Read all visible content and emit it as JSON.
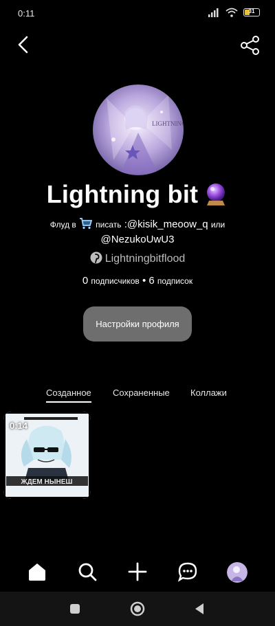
{
  "status": {
    "time": "0:11",
    "battery": "31"
  },
  "profile": {
    "name": "Lightning bit",
    "bio_pre": "Флуд в",
    "bio_mid": "писать",
    "bio_handle1": ":@kisik_meoow_q",
    "bio_or": "или",
    "bio_handle2": "@NezukoUwU3",
    "pinterest": "Lightningbitflood",
    "followers_count": "0",
    "followers_label": "подписчиков",
    "following_count": "6",
    "following_label": "подписок",
    "separator": "•",
    "settings_button": "Настройки профиля",
    "avatar_text": "LIGHTNING BIT"
  },
  "tabs": [
    "Созданное",
    "Сохраненные",
    "Коллажи"
  ],
  "pins": [
    {
      "duration": "0:14",
      "caption": "ЖДЕМ НЫНЕШ"
    }
  ],
  "icons": {
    "back": "chevron-left-icon",
    "share": "share-icon",
    "nav": [
      "home-icon",
      "search-icon",
      "plus-icon",
      "chat-icon",
      "profile-avatar"
    ],
    "system": [
      "recents-icon",
      "home-circle-icon",
      "back-triangle-icon"
    ]
  },
  "colors": {
    "background": "#000000",
    "settings_button": "#6e6e6e",
    "system_bar": "#141414"
  }
}
